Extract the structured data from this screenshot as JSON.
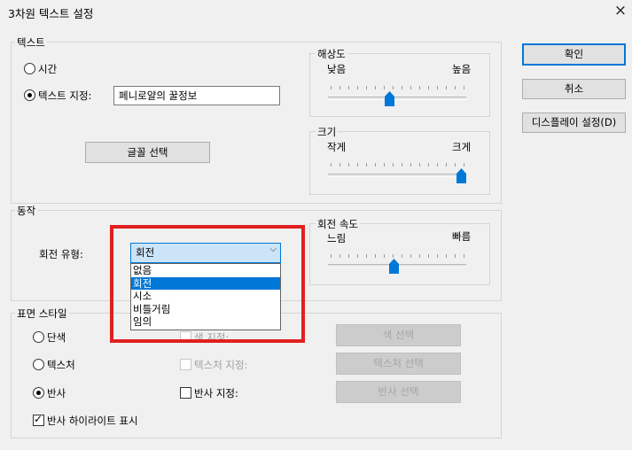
{
  "window": {
    "title": "3차원 텍스트 설정",
    "close_icon": "×"
  },
  "text_group": {
    "label": "텍스트",
    "radio_time": "시간",
    "radio_custom": "텍스트 지정:",
    "custom_value": "페니로얄의 꿀정보",
    "font_button": "글꼴 선택"
  },
  "resolution": {
    "label": "해상도",
    "min": "낮음",
    "max": "높음",
    "level": 0.5
  },
  "size": {
    "label": "크기",
    "min": "작게",
    "max": "크게",
    "level": 1.0
  },
  "motion_group": {
    "label": "동작",
    "rotation_type_label": "회전 유형:",
    "rotation_type_value": "회전",
    "options": [
      "없음",
      "회전",
      "시소",
      "비틀거림",
      "임의"
    ],
    "selected_index": 1
  },
  "rotation_speed": {
    "label": "회전 속도",
    "min": "느림",
    "max": "빠름",
    "level": 0.4
  },
  "surface_group": {
    "label": "표면 스타일",
    "radio_solid": "단색",
    "radio_texture": "텍스처",
    "radio_reflect": "반사",
    "color_check": "색 지정:",
    "texture_check": "텍스처 지정:",
    "reflect_check": "반사 지정:",
    "color_button": "색 선택",
    "texture_button": "텍스처 선택",
    "reflect_button": "반사 선택",
    "highlight_check": "반사 하이라이트 표시"
  },
  "buttons": {
    "ok": "확인",
    "cancel": "취소",
    "display": "디스플레이 설정(D)"
  },
  "colors": {
    "accent": "#0078d7",
    "highlight_box": "#e02020"
  }
}
